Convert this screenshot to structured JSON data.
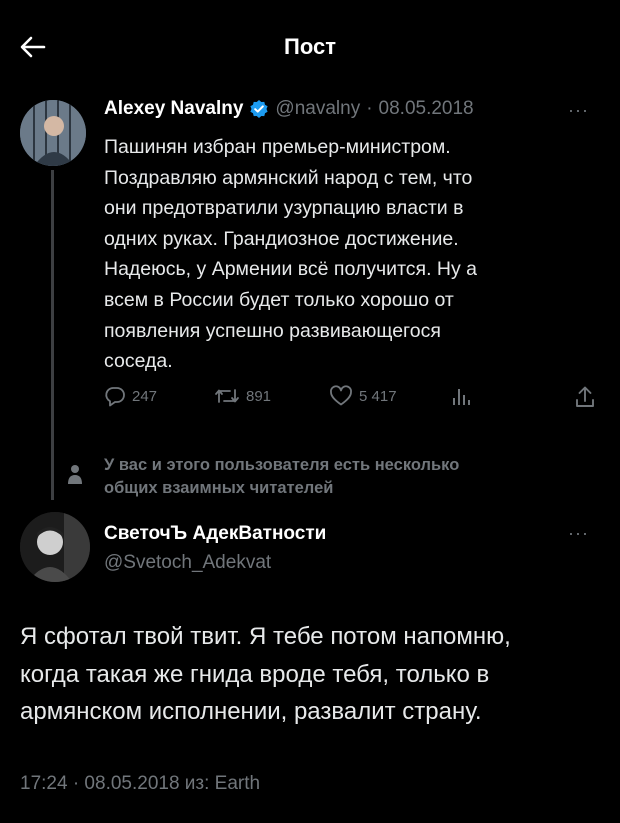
{
  "header": {
    "title": "Пост"
  },
  "original_tweet": {
    "author_name": "Alexey Navalny",
    "handle": "@navalny",
    "date": "08.05.2018",
    "lines": [
      "Пашинян избран премьер-министром.",
      "Поздравляю армянский народ с тем, что",
      "они предотвратили узурпацию власти в",
      "одних руках. Грандиозное достижение.",
      "Надеюсь, у Армении всё получится. Ну а",
      "всем в России будет только хорошо от",
      "появления успешно развивающегося",
      "соседа."
    ],
    "replies": "247",
    "retweets": "891",
    "likes": "5 417",
    "more": "···"
  },
  "social_context": {
    "line1": "У вас и этого пользователя есть несколько",
    "line2": "общих взаимных читателей"
  },
  "reply_tweet": {
    "author_name": "СветочЪ АдекВатности",
    "handle": "@Svetoch_Adekvat",
    "more": "···",
    "lines": [
      "Я сфотал твой твит. Я тебе потом напомню,",
      "когда такая же гнида вроде тебя, только в",
      "армянском исполнении, развалит страну."
    ],
    "meta": "17:24 · 08.05.2018 из: Earth"
  },
  "colors": {
    "background": "#000000",
    "text": "#e7e9ea",
    "muted": "#71767b",
    "verified": "#1d9bf0"
  }
}
